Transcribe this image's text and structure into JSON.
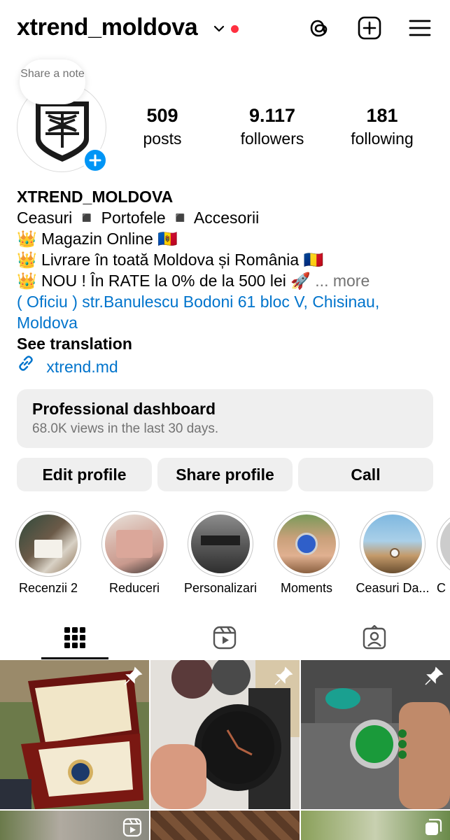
{
  "header": {
    "username": "xtrend_moldova",
    "icons": [
      "chevron-down-icon",
      "threads-icon",
      "new-post-icon",
      "menu-icon"
    ],
    "notification_color": "#ff3040"
  },
  "note": {
    "text": "Share a note"
  },
  "stats": {
    "posts": {
      "value": "509",
      "label": "posts"
    },
    "followers": {
      "value": "9.117",
      "label": "followers"
    },
    "following": {
      "value": "181",
      "label": "following"
    }
  },
  "bio": {
    "name": "XTREND_MOLDOVA",
    "line1": "Ceasuri ◾ Portofele ◾ Accesorii",
    "line2": "👑 Magazin Online 🇲🇩",
    "line3": "👑 Livrare în toată Moldova și România 🇷🇴",
    "line4": "👑 NOU ! În RATE la 0% de la 500 lei 🚀",
    "more": "... more",
    "address_line1": "( Oficiu ) str.Banulescu Bodoni 61 bloc V, Chisinau,",
    "address_line2": "Moldova",
    "see_translation": "See translation",
    "link": "xtrend.md"
  },
  "dashboard": {
    "title": "Professional dashboard",
    "subtitle": "68.0K views in the last 30 days."
  },
  "buttons": {
    "edit": "Edit profile",
    "share": "Share profile",
    "call": "Call"
  },
  "highlights": [
    {
      "label": "Recenzii 2"
    },
    {
      "label": "Reduceri"
    },
    {
      "label": "Personalizari"
    },
    {
      "label": "Moments"
    },
    {
      "label": "Ceasuri Da..."
    },
    {
      "label": "C"
    }
  ],
  "tabs": [
    "grid-icon",
    "reels-icon",
    "tagged-icon"
  ],
  "colors": {
    "accent": "#0095f6",
    "link": "#0074cc",
    "muted": "#737373",
    "button_bg": "#efefef"
  }
}
